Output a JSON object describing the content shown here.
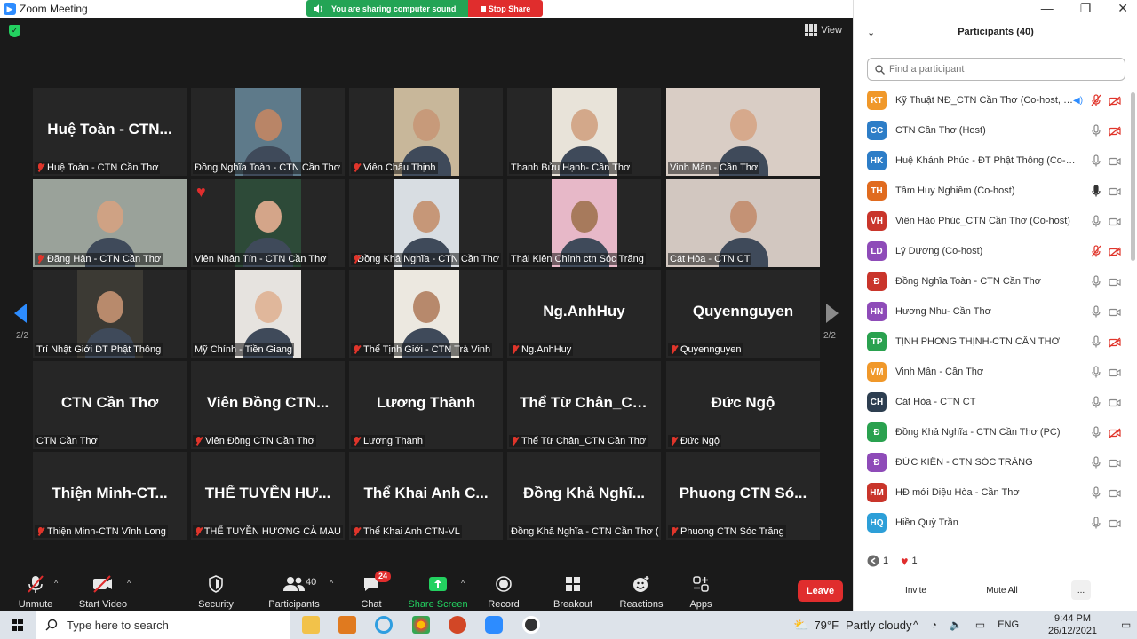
{
  "window": {
    "title": "Zoom Meeting"
  },
  "share_banner": {
    "sharing_text": "You are sharing computer sound",
    "stop_label": "Stop Share"
  },
  "meeting": {
    "view_label": "View",
    "page_indicator": "2/2",
    "tiles": [
      {
        "name": "Huệ Toàn - CTN Cần Thơ",
        "display": "Huệ Toàn - CTN...",
        "muted": true,
        "video": false
      },
      {
        "name": "Đồng Nghĩa Toàn - CTN Cần Thơ",
        "muted": false,
        "video": true,
        "bg": "#5e7a8a",
        "skin": "#b98567"
      },
      {
        "name": "Viên Châu Thịnh",
        "muted": true,
        "video": true,
        "bg": "#c8b79a",
        "skin": "#c79a7a"
      },
      {
        "name": "Thanh Bửu Hạnh- Cần Thơ",
        "muted": false,
        "video": true,
        "bg": "#e8e3d9",
        "skin": "#d3a88a"
      },
      {
        "name": "Vinh Mẫn - Cần Thơ",
        "muted": false,
        "video": true,
        "bg": "#d9cdc5",
        "skin": "#d6a98c",
        "wide": true
      },
      {
        "name": "Đăng Hân - CTN Cần Thơ",
        "muted": true,
        "video": true,
        "bg": "#9aa29a",
        "skin": "#cfa284",
        "wide": true
      },
      {
        "name": "Viên Nhân Tín - CTN Cần Thơ",
        "muted": false,
        "video": true,
        "bg": "#2d4a38",
        "skin": "#d4a589",
        "reaction": "heart"
      },
      {
        "name": "Đồng Khả Nghĩa - CTN Cần Thơ",
        "muted": true,
        "video": true,
        "bg": "#d8dde2",
        "skin": "#c69778"
      },
      {
        "name": "Thái Kiên Chính ctn Sóc Trăng",
        "muted": false,
        "video": true,
        "bg": "#e7b8c8",
        "skin": "#a77a5c"
      },
      {
        "name": "Cát Hòa - CTN CT",
        "muted": false,
        "video": true,
        "bg": "#d2c7c0",
        "skin": "#c49275",
        "wide": true
      },
      {
        "name": "Trí Nhật Giới DT Phật Thông",
        "muted": false,
        "video": true,
        "bg": "#3c3a34",
        "skin": "#b88a6c"
      },
      {
        "name": "Mỹ Chính - Tiền Giang",
        "muted": false,
        "video": true,
        "bg": "#e6e3df",
        "skin": "#e0b79b"
      },
      {
        "name": "Thể Tịnh Giới - CTN Trà Vinh",
        "muted": true,
        "video": true,
        "bg": "#ece8e0",
        "skin": "#b7896c"
      },
      {
        "name": "Ng.AnhHuy",
        "display": "Ng.AnhHuy",
        "muted": true,
        "video": false
      },
      {
        "name": "Quyennguyen",
        "display": "Quyennguyen",
        "muted": true,
        "video": false
      },
      {
        "name": "CTN Cần Thơ",
        "display": "CTN Cần Thơ",
        "muted": false,
        "video": false
      },
      {
        "name": "Viên Đồng CTN Cần Thơ",
        "display": "Viên Đồng CTN...",
        "muted": true,
        "video": false
      },
      {
        "name": "Lương Thành",
        "display": "Lương Thành",
        "muted": true,
        "video": false
      },
      {
        "name": "Thể Từ Chân_CTN Cần Thơ",
        "display": "Thể Từ Chân_CT...",
        "muted": true,
        "video": false
      },
      {
        "name": "Đức Ngộ",
        "display": "Đức Ngộ",
        "muted": true,
        "video": false
      },
      {
        "name": "Thiện Minh-CTN Vĩnh Long",
        "display": "Thiện  Minh-CT...",
        "muted": true,
        "video": false
      },
      {
        "name": "THỂ TUYỀN HƯƠNG CÀ MAU",
        "display": "THỂ TUYỀN HƯ...",
        "muted": true,
        "video": false
      },
      {
        "name": "Thể Khai Anh CTN-VL",
        "display": "Thể Khai Anh C...",
        "muted": true,
        "video": false
      },
      {
        "name": "Đồng Khả Nghĩa - CTN Cần Thơ (P...",
        "display": "Đồng Khả Nghĩ...",
        "muted": false,
        "video": false
      },
      {
        "name": "Phuong CTN Sóc Trăng",
        "display": "Phuong CTN Só...",
        "muted": true,
        "video": false
      }
    ]
  },
  "toolbar": {
    "unmute": "Unmute",
    "start_video": "Start Video",
    "security": "Security",
    "participants": "Participants",
    "participants_count": "40",
    "chat": "Chat",
    "chat_badge": "24",
    "share_screen": "Share Screen",
    "record": "Record",
    "breakout_rooms": "Breakout Rooms",
    "reactions": "Reactions",
    "apps": "Apps",
    "leave": "Leave"
  },
  "panel": {
    "title": "Participants (40)",
    "search_placeholder": "Find a participant",
    "participants": [
      {
        "initials": "KT",
        "color": "#f0982a",
        "name": "Kỹ Thuật NĐ_CTN Cần Thơ (Co-host, me)",
        "mic": "off",
        "cam": "off",
        "speaker": true
      },
      {
        "initials": "CC",
        "color": "#2d7dc7",
        "name": "CTN Cần Thơ (Host)",
        "mic": "on",
        "cam": "off"
      },
      {
        "initials": "HK",
        "color": "#2d7dc7",
        "name": "Huệ Khánh Phúc - ĐT Phật Thông (Co-host)",
        "mic": "on",
        "cam": "on"
      },
      {
        "initials": "TH",
        "color": "#e06b1f",
        "name": "Tâm Huy Nghiêm (Co-host)",
        "mic": "active",
        "cam": "on"
      },
      {
        "initials": "VH",
        "color": "#c9352b",
        "name": "Viên Hảo Phúc_CTN Cần Thơ (Co-host)",
        "mic": "on",
        "cam": "on"
      },
      {
        "initials": "LD",
        "color": "#8e4bb8",
        "name": "Lý Dương (Co-host)",
        "mic": "off",
        "cam": "off"
      },
      {
        "initials": "Đ",
        "color": "#c9352b",
        "name": "Đồng Nghĩa Toàn - CTN Cần Thơ",
        "mic": "on",
        "cam": "on"
      },
      {
        "initials": "HN",
        "color": "#8e4bb8",
        "name": "Hương Nhu- Cần Thơ",
        "mic": "on",
        "cam": "on"
      },
      {
        "initials": "TP",
        "color": "#2aa14f",
        "name": "TỊNH PHONG THỊNH-CTN CẦN THƠ",
        "mic": "on",
        "cam": "off"
      },
      {
        "initials": "VM",
        "color": "#f0982a",
        "name": "Vinh Mẫn - Cần Thơ",
        "mic": "on",
        "cam": "on"
      },
      {
        "initials": "CH",
        "color": "#2d3e50",
        "name": "Cát Hòa - CTN CT",
        "mic": "on",
        "cam": "on"
      },
      {
        "initials": "Đ",
        "color": "#2aa14f",
        "name": "Đồng Khả Nghĩa - CTN Cần Thơ (PC)",
        "mic": "on",
        "cam": "off"
      },
      {
        "initials": "Đ",
        "color": "#8e4bb8",
        "name": "ĐỨC KIẾN - CTN SÓC TRĂNG",
        "mic": "on",
        "cam": "on"
      },
      {
        "initials": "HM",
        "color": "#c9352b",
        "name": "HĐ mới Diệu Hòa - Cần Thơ",
        "mic": "on",
        "cam": "on"
      },
      {
        "initials": "HQ",
        "color": "#2d9fd8",
        "name": "Hiền Quỳ Trần",
        "mic": "on",
        "cam": "on"
      }
    ],
    "reaction_counts": {
      "raise": "1",
      "heart": "1"
    },
    "invite": "Invite",
    "mute_all": "Mute All",
    "more": "..."
  },
  "taskbar": {
    "search_placeholder": "Type here to search",
    "weather_temp": "79°F",
    "weather_desc": "Partly cloudy",
    "lang": "ENG",
    "time": "9:44 PM",
    "date": "26/12/2021"
  }
}
